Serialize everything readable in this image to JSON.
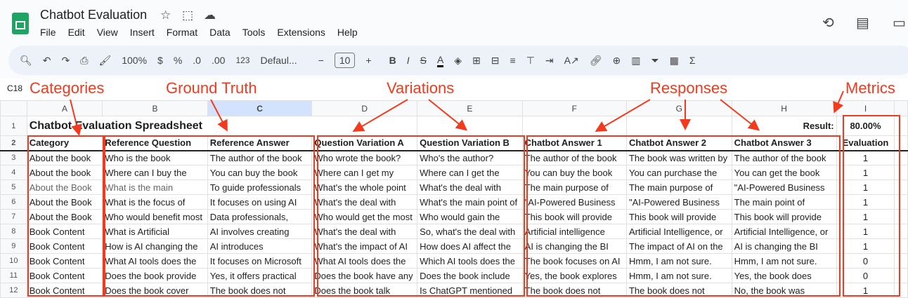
{
  "app": {
    "title": "Chatbot Evaluation",
    "menu": [
      "File",
      "Edit",
      "View",
      "Insert",
      "Format",
      "Data",
      "Tools",
      "Extensions",
      "Help"
    ],
    "toolbar": {
      "zoom": "100%",
      "currency": "$",
      "percent": "%",
      "dec_less": ".0",
      "dec_more": ".00",
      "format_123": "123",
      "font": "Defaul...",
      "font_size": "10"
    },
    "namebox": "C18"
  },
  "annotations": {
    "categories": "Categories",
    "ground_truth": "Ground Truth",
    "variations": "Variations",
    "responses": "Responses",
    "metrics": "Metrics"
  },
  "accent": "#f23a1e",
  "sheet": {
    "columns": [
      "A",
      "B",
      "C",
      "D",
      "E",
      "F",
      "G",
      "H",
      "I"
    ],
    "title": "Chatbot Evaluation Spreadsheet",
    "result_label": "Result:",
    "result_value": "80.00%",
    "headers": [
      "Category",
      "Reference Question",
      "Reference Answer",
      "Question Variation A",
      "Question Variation B",
      "Chatbot Answer 1",
      "Chatbot Answer 2",
      "Chatbot Answer 3",
      "Evaluation"
    ],
    "rows": [
      [
        "About the book",
        "Who is the book",
        "The author of the book",
        "Who wrote the book?",
        "Who's the author?",
        "The author of the book",
        "The book was written by",
        "The author of the book",
        "1"
      ],
      [
        "About the book",
        "Where can I buy the",
        "You can buy the book",
        "Where can I get my",
        "Where can I get the",
        "You can buy the book",
        "You can purchase the",
        "You can get the book",
        "1"
      ],
      [
        "About the Book",
        "What is the main",
        "To guide professionals",
        "What's the whole point",
        "What's the deal with",
        "The main purpose of",
        "The main purpose of",
        "\"AI-Powered Business",
        "1"
      ],
      [
        "About the Book",
        "What is the focus of",
        "It focuses on using AI",
        "What's the deal with",
        "What's the main point of",
        "\"AI-Powered Business",
        "\"AI-Powered Business",
        "The main point of",
        "1"
      ],
      [
        "About the Book",
        "Who would benefit most",
        "Data professionals,",
        "Who would get the most",
        "Who would gain the",
        "This book will provide",
        "This book will provide",
        "This book will provide",
        "1"
      ],
      [
        "Book Content",
        "What is Artificial",
        "AI involves creating",
        "What's the deal with",
        "So, what's the deal with",
        "Artificial intelligence",
        "Artificial Intelligence, or",
        "Artificial Intelligence, or",
        "1"
      ],
      [
        "Book Content",
        "How is AI changing the",
        "AI introduces",
        "What's the impact of AI",
        "How does AI affect the",
        "AI is changing the BI",
        "The impact of AI on the",
        "AI is changing the BI",
        "1"
      ],
      [
        "Book Content",
        "What AI tools does the",
        "It focuses on Microsoft",
        "What AI tools does the",
        "Which AI tools does the",
        "The book focuses on AI",
        "Hmm, I am not sure.",
        "Hmm, I am not sure.",
        "0"
      ],
      [
        "Book Content",
        "Does the book provide",
        "Yes, it offers practical",
        "Does the book have any",
        "Does the book include",
        "Yes, the book explores",
        "Hmm, I am not sure.",
        "Yes, the book does",
        "0"
      ],
      [
        "Book Content",
        "Does the book cover",
        "The book does not",
        "Does the book talk",
        "Is ChatGPT mentioned",
        "The book does not",
        "The book does not",
        "No, the book was",
        "1"
      ]
    ]
  }
}
